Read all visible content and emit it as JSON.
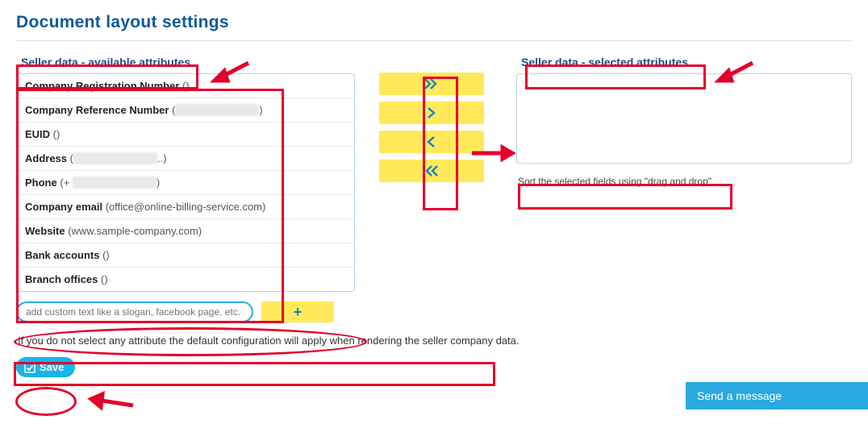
{
  "title": "Document layout settings",
  "left": {
    "header": "Seller data - available attributes",
    "items": [
      {
        "label": "Company Registration Number",
        "value": "()"
      },
      {
        "label": "Company Reference Number",
        "value": "(",
        "redacted": true,
        "tail": ")"
      },
      {
        "label": "EUID",
        "value": "()"
      },
      {
        "label": "Address",
        "value": "(",
        "redacted": true,
        "tail": "..)"
      },
      {
        "label": "Phone",
        "value": "(+ ",
        "redacted": true,
        "tail": ")"
      },
      {
        "label": "Company email",
        "value": "(office@online-billing-service.com)"
      },
      {
        "label": "Website",
        "value": "(www.sample-company.com)"
      },
      {
        "label": "Bank accounts",
        "value": "()"
      },
      {
        "label": "Branch offices",
        "value": "()"
      }
    ]
  },
  "right": {
    "header": "Seller data - selected attributes",
    "hint": "Sort the selected fields using \"drag and drop\""
  },
  "buttons": {
    "move_all_right": "»",
    "move_right": "›",
    "move_left": "‹",
    "move_all_left": "«"
  },
  "custom": {
    "placeholder": "add custom text like a slogan, facebook page, etc.",
    "add_label": "+"
  },
  "notice": "If you do not select any attribute the default configuration will apply when rendering the seller company data.",
  "save_label": "Save",
  "chat_label": "Send a message"
}
